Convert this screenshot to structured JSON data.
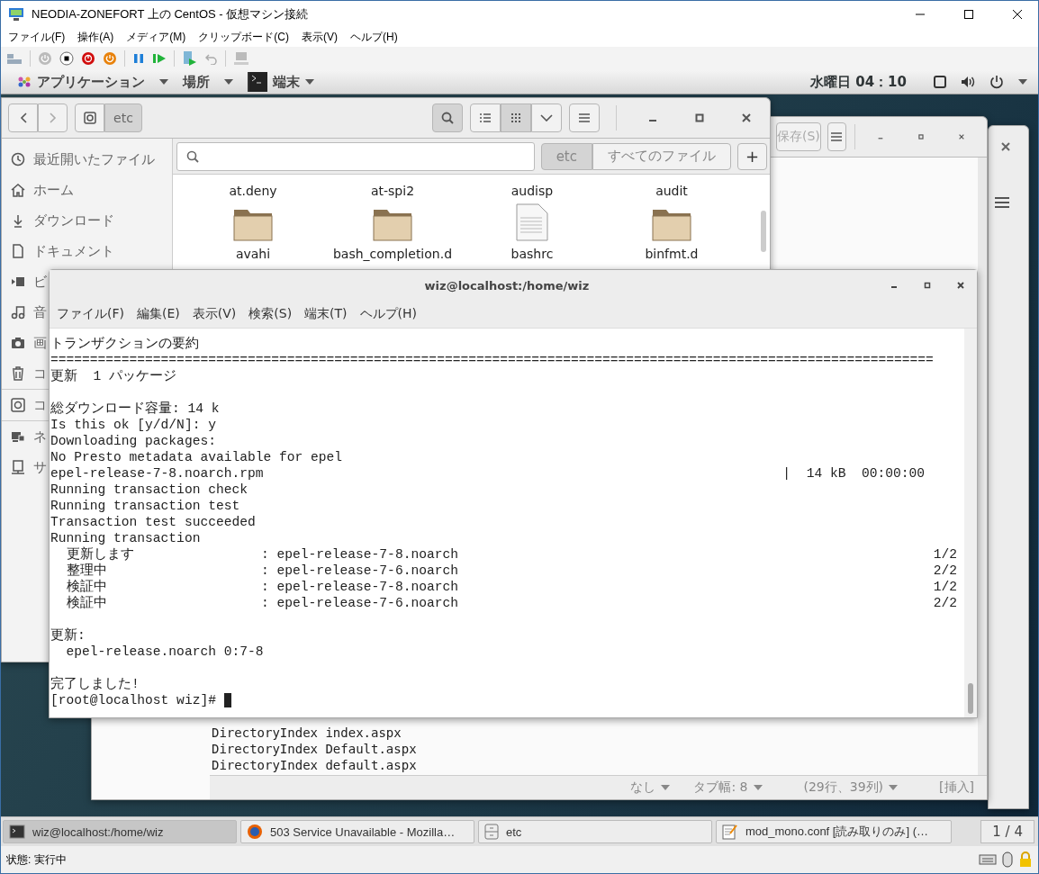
{
  "window": {
    "title": "NEODIA-ZONEFORT 上の CentOS - 仮想マシン接続"
  },
  "menu": [
    "ファイル(F)",
    "操作(A)",
    "メディア(M)",
    "クリップボード(C)",
    "表示(V)",
    "ヘルプ(H)"
  ],
  "top_bar": {
    "applications": "アプリケーション",
    "places": "場所",
    "active_app": "端末",
    "clock": "水曜日 04：10"
  },
  "editor": {
    "save_button": "保存(S)",
    "lines": [
      "DirectoryIndex index.aspx",
      "DirectoryIndex Default.aspx",
      "DirectoryIndex default.aspx"
    ],
    "status": {
      "language": "なし",
      "tab_width": "タブ幅: 8",
      "position": "(29行、39列)",
      "mode": "[挿入]"
    }
  },
  "file_manager": {
    "path": "etc",
    "search_on": true,
    "view_modes": [
      {
        "kind": "list",
        "selected": false
      },
      {
        "kind": "grid",
        "selected": true
      }
    ],
    "scopes": [
      {
        "label": "etc",
        "selected": true
      },
      {
        "label": "すべてのファイル",
        "selected": false
      }
    ],
    "add_button": "+",
    "sidebar": [
      {
        "kind": "recent",
        "label": "最近開いたファイル"
      },
      {
        "kind": "home",
        "label": "ホーム"
      },
      {
        "kind": "download",
        "label": "ダウンロード"
      },
      {
        "kind": "document",
        "label": "ドキュメント"
      },
      {
        "kind": "video",
        "label": "ビ"
      },
      {
        "kind": "music",
        "label": "音"
      },
      {
        "kind": "photo",
        "label": "画"
      },
      {
        "kind": "trash",
        "label": "コ"
      },
      {
        "kind": "disk",
        "label": "コ"
      },
      {
        "kind": "network",
        "label": "ネ"
      },
      {
        "kind": "server",
        "label": "サ"
      }
    ],
    "files": [
      {
        "name": "at.deny"
      },
      {
        "name": "at-spi2"
      },
      {
        "name": "audisp"
      },
      {
        "name": "audit"
      },
      {
        "name": "avahi",
        "kind": "folder"
      },
      {
        "name": "bash_completion.d",
        "kind": "folder"
      },
      {
        "name": "bashrc",
        "kind": "file"
      },
      {
        "name": "binfmt.d",
        "kind": "folder"
      }
    ]
  },
  "terminal": {
    "title": "wiz@localhost:/home/wiz",
    "menu": [
      "ファイル(F)",
      "編集(E)",
      "表示(V)",
      "検索(S)",
      "端末(T)",
      "ヘルプ(H)"
    ],
    "lines": [
      {
        "kind": "text",
        "text": "トランザクションの要約"
      },
      {
        "kind": "text",
        "text": "================================================================================================================"
      },
      {
        "kind": "text",
        "text": "更新  1 パッケージ"
      },
      {
        "kind": "blank"
      },
      {
        "kind": "text",
        "text": "総ダウンロード容量: 14 k"
      },
      {
        "kind": "text",
        "text": "Is this ok [y/d/N]: y"
      },
      {
        "kind": "text",
        "text": "Downloading packages:"
      },
      {
        "kind": "text",
        "text": "No Presto metadata available for epel"
      },
      {
        "kind": "progress",
        "text": "epel-release-7-8.noarch.rpm",
        "right": "|  14 kB  00:00:00"
      },
      {
        "kind": "text",
        "text": "Running transaction check"
      },
      {
        "kind": "text",
        "text": "Running transaction test"
      },
      {
        "kind": "text",
        "text": "Transaction test succeeded"
      },
      {
        "kind": "text",
        "text": "Running transaction"
      },
      {
        "kind": "step",
        "label": "更新します",
        "text": ": epel-release-7-8.noarch",
        "right": "1/2"
      },
      {
        "kind": "step",
        "label": "整理中",
        "text": ": epel-release-7-6.noarch",
        "right": "2/2"
      },
      {
        "kind": "step",
        "label": "検証中",
        "text": ": epel-release-7-8.noarch",
        "right": "1/2"
      },
      {
        "kind": "step",
        "label": "検証中",
        "text": ": epel-release-7-6.noarch",
        "right": "2/2"
      },
      {
        "kind": "blank"
      },
      {
        "kind": "text",
        "text": "更新:"
      },
      {
        "kind": "text",
        "text": "  epel-release.noarch 0:7-8"
      },
      {
        "kind": "blank"
      },
      {
        "kind": "text",
        "text": "完了しました!"
      },
      {
        "kind": "prompt",
        "text": "[root@localhost wiz]#"
      }
    ]
  },
  "taskbar": {
    "items": [
      {
        "kind": "terminal",
        "label": "wiz@localhost:/home/wiz",
        "selected": true
      },
      {
        "kind": "browser",
        "label": "503 Service Unavailable - Mozilla…",
        "selected": false
      },
      {
        "kind": "files",
        "label": "etc",
        "selected": false
      },
      {
        "kind": "editor",
        "label": "mod_mono.conf [読み取りのみ] (…",
        "selected": false
      }
    ],
    "workspace": "1 / 4"
  },
  "status_bar": {
    "state": "状態: 実行中"
  }
}
